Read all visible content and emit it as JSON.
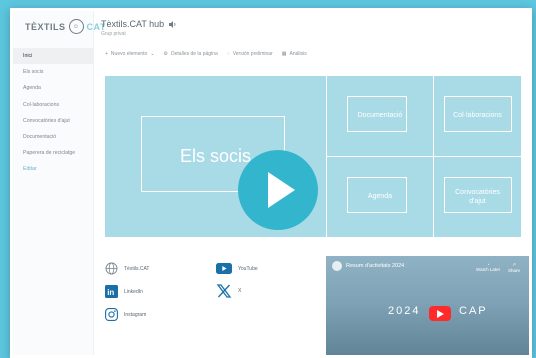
{
  "sidebar": {
    "logo": {
      "left": "TÈXTILS",
      "mark": "☺",
      "right": "CAT"
    },
    "items": [
      {
        "label": "Inici",
        "active": true
      },
      {
        "label": "Els socis"
      },
      {
        "label": "Agenda"
      },
      {
        "label": "Col·laboracions"
      },
      {
        "label": "Convocatòries d'ajut"
      },
      {
        "label": "Documentació"
      },
      {
        "label": "Paperera de reciclatge"
      },
      {
        "label": "Editar",
        "edit": true
      }
    ]
  },
  "header": {
    "title": "Tèxtils.CAT hub",
    "subtitle": "Grup privat"
  },
  "toolbar": {
    "new_item": "Nuevo elemento",
    "page_details": "Detalles de la página",
    "preview": "Versión preliminar",
    "analytics": "Análisis"
  },
  "tiles": {
    "main": "Els socis",
    "documentacio": "Documentació",
    "collaboracions": "Col·laboracions",
    "agenda": "Agenda",
    "convocatories_line1": "Convocatòries",
    "convocatories_line2": "d'ajut"
  },
  "links": {
    "web": "Tèxtils.CAT",
    "youtube": "YouTube",
    "linkedin": "LinkedIn",
    "x": "X",
    "instagram": "Instagram"
  },
  "video": {
    "title": "Resum d'activitats 2024",
    "watch_later": "Watch Later",
    "share": "Share",
    "year": "2024",
    "cap": "CAP"
  },
  "colors": {
    "page_bg": "#5dc7e0",
    "tile_bg": "#a9dbe7",
    "play": "#33b6cd",
    "youtube_red": "#ff2a2a"
  }
}
